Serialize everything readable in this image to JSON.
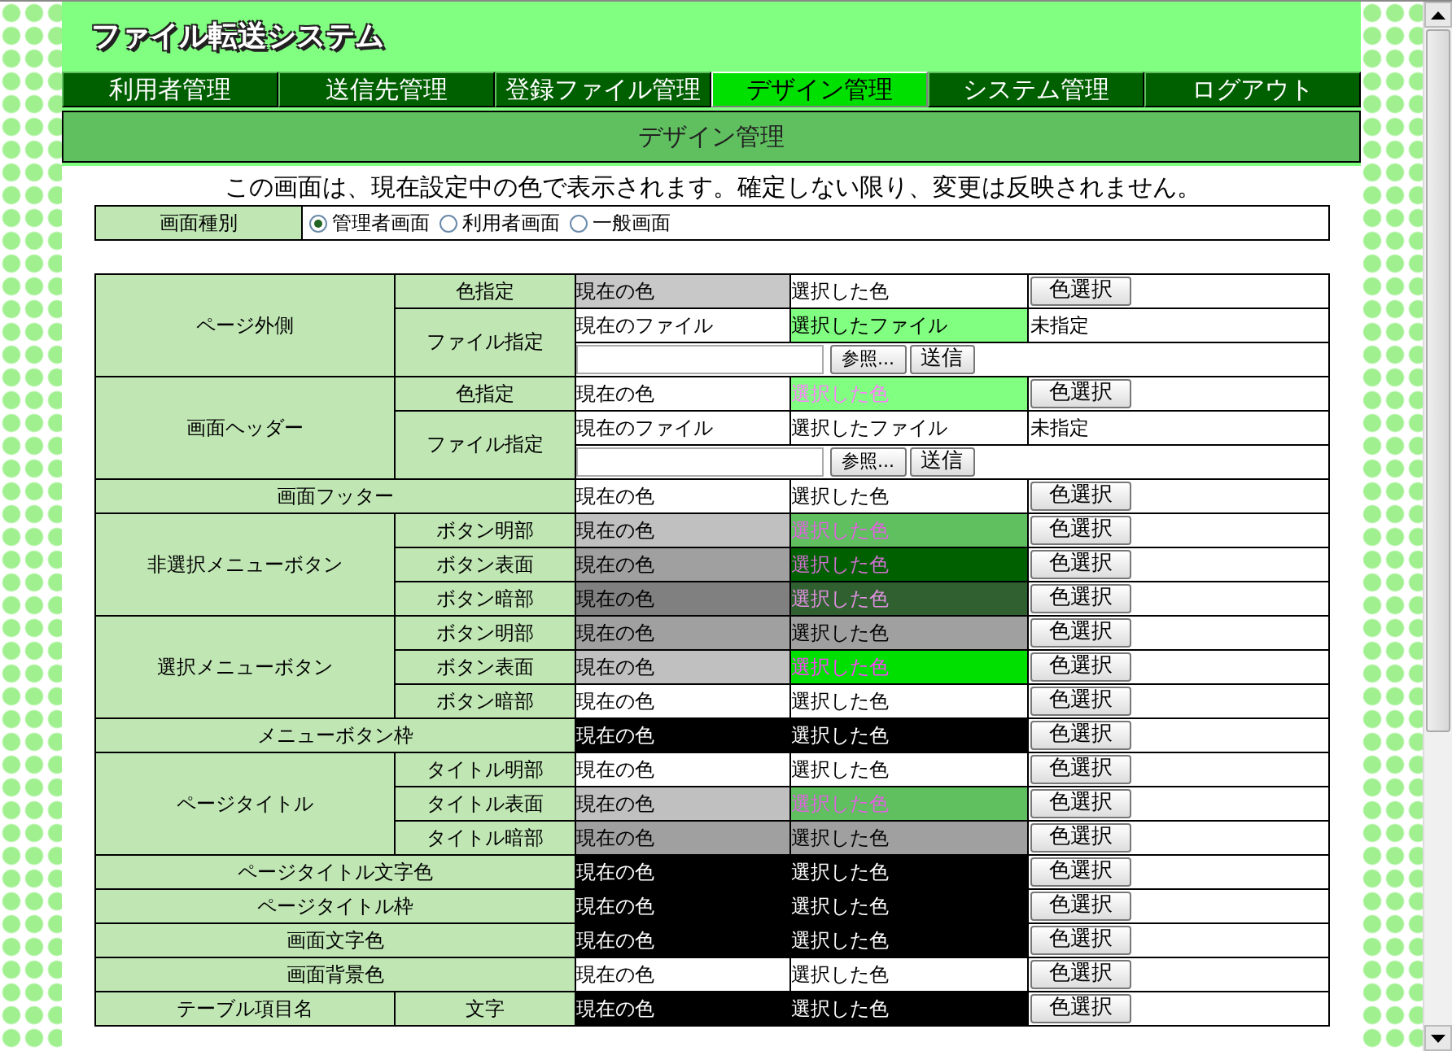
{
  "logo": "ファイル転送システム",
  "menu": [
    {
      "label": "利用者管理",
      "selected": false
    },
    {
      "label": "送信先管理",
      "selected": false
    },
    {
      "label": "登録ファイル管理",
      "selected": false
    },
    {
      "label": "デザイン管理",
      "selected": true
    },
    {
      "label": "システム管理",
      "selected": false
    },
    {
      "label": "ログアウト",
      "selected": false
    }
  ],
  "page_title": "デザイン管理",
  "notice": "この画面は、現在設定中の色で表示されます。確定しない限り、変更は反映されません。",
  "screen_type": {
    "label": "画面種別",
    "options": [
      {
        "label": "管理者画面",
        "selected": true
      },
      {
        "label": "利用者画面",
        "selected": false
      },
      {
        "label": "一般画面",
        "selected": false
      }
    ]
  },
  "settings": [
    {
      "label": "ページ外側",
      "items": [
        {
          "label": "色指定",
          "kind": "color",
          "current": {
            "text": "現在の色",
            "color": "#c8c8c8"
          },
          "chosen": {
            "text": "選択した色",
            "color": "#ffffff"
          },
          "button": "色選択"
        },
        {
          "label": "ファイル指定",
          "kind": "file",
          "current": {
            "text": "現在のファイル",
            "color": "#ffffff"
          },
          "chosen": {
            "text": "選択したファイル",
            "color": "#80ff80"
          },
          "status": "未指定",
          "browse_button": "参照...",
          "send_button": "送信"
        }
      ]
    },
    {
      "label": "画面ヘッダー",
      "items": [
        {
          "label": "色指定",
          "kind": "color",
          "current": {
            "text": "現在の色",
            "color": "#ffffff"
          },
          "chosen": {
            "text": "選択した色",
            "color": "#80ff80",
            "ink": {
              "color": "#ff80ff"
            }
          },
          "button": "色選択"
        },
        {
          "label": "ファイル指定",
          "kind": "file",
          "current": {
            "text": "現在のファイル",
            "color": "#ffffff"
          },
          "chosen": {
            "text": "選択したファイル",
            "color": "#ffffff"
          },
          "status": "未指定",
          "browse_button": "参照...",
          "send_button": "送信"
        }
      ]
    },
    {
      "label": "画面フッター",
      "items": [
        {
          "kind": "color",
          "current": {
            "text": "現在の色",
            "color": "#ffffff"
          },
          "chosen": {
            "text": "選択した色",
            "color": "#ffffff"
          },
          "button": "色選択"
        }
      ]
    },
    {
      "label": "非選択メニューボタン",
      "items": [
        {
          "label": "ボタン明部",
          "kind": "color",
          "current": {
            "text": "現在の色",
            "color": "#c0c0c0"
          },
          "chosen": {
            "text": "選択した色",
            "color": "#60c060",
            "ink": {
              "color": "#e060e0"
            }
          },
          "button": "色選択"
        },
        {
          "label": "ボタン表面",
          "kind": "color",
          "current": {
            "text": "現在の色",
            "color": "#a0a0a0"
          },
          "chosen": {
            "text": "選択した色",
            "color": "#006000",
            "ink": {
              "color": "#d070d0"
            }
          },
          "button": "色選択"
        },
        {
          "label": "ボタン暗部",
          "kind": "color",
          "current": {
            "text": "現在の色",
            "color": "#808080"
          },
          "chosen": {
            "text": "選択した色",
            "color": "#306030",
            "ink": {
              "color": "#e090e0"
            }
          },
          "button": "色選択"
        }
      ]
    },
    {
      "label": "選択メニューボタン",
      "items": [
        {
          "label": "ボタン明部",
          "kind": "color",
          "current": {
            "text": "現在の色",
            "color": "#a0a0a0"
          },
          "chosen": {
            "text": "選択した色",
            "color": "#a0a0a0"
          },
          "button": "色選択"
        },
        {
          "label": "ボタン表面",
          "kind": "color",
          "current": {
            "text": "現在の色",
            "color": "#c0c0c0"
          },
          "chosen": {
            "text": "選択した色",
            "color": "#00e000",
            "ink": {
              "color": "#ff40ff"
            }
          },
          "button": "色選択"
        },
        {
          "label": "ボタン暗部",
          "kind": "color",
          "current": {
            "text": "現在の色",
            "color": "#ffffff"
          },
          "chosen": {
            "text": "選択した色",
            "color": "#ffffff"
          },
          "button": "色選択"
        }
      ]
    },
    {
      "label": "メニューボタン枠",
      "items": [
        {
          "kind": "color",
          "current": {
            "text": "現在の色",
            "color": "#000000"
          },
          "chosen": {
            "text": "選択した色",
            "color": "#000000"
          },
          "button": "色選択"
        }
      ]
    },
    {
      "label": "ページタイトル",
      "items": [
        {
          "label": "タイトル明部",
          "kind": "color",
          "current": {
            "text": "現在の色",
            "color": "#ffffff"
          },
          "chosen": {
            "text": "選択した色",
            "color": "#ffffff"
          },
          "button": "色選択"
        },
        {
          "label": "タイトル表面",
          "kind": "color",
          "current": {
            "text": "現在の色",
            "color": "#c0c0c0"
          },
          "chosen": {
            "text": "選択した色",
            "color": "#60c060",
            "ink": {
              "color": "#e060e0"
            }
          },
          "button": "色選択"
        },
        {
          "label": "タイトル暗部",
          "kind": "color",
          "current": {
            "text": "現在の色",
            "color": "#a0a0a0"
          },
          "chosen": {
            "text": "選択した色",
            "color": "#a0a0a0"
          },
          "button": "色選択"
        }
      ]
    },
    {
      "label": "ページタイトル文字色",
      "items": [
        {
          "kind": "color",
          "current": {
            "text": "現在の色",
            "color": "#000000"
          },
          "chosen": {
            "text": "選択した色",
            "color": "#000000"
          },
          "button": "色選択"
        }
      ]
    },
    {
      "label": "ページタイトル枠",
      "items": [
        {
          "kind": "color",
          "current": {
            "text": "現在の色",
            "color": "#000000"
          },
          "chosen": {
            "text": "選択した色",
            "color": "#000000"
          },
          "button": "色選択"
        }
      ]
    },
    {
      "label": "画面文字色",
      "items": [
        {
          "kind": "color",
          "current": {
            "text": "現在の色",
            "color": "#000000"
          },
          "chosen": {
            "text": "選択した色",
            "color": "#000000"
          },
          "button": "色選択"
        }
      ]
    },
    {
      "label": "画面背景色",
      "items": [
        {
          "kind": "color",
          "current": {
            "text": "現在の色",
            "color": "#ffffff"
          },
          "chosen": {
            "text": "選択した色",
            "color": "#ffffff"
          },
          "button": "色選択"
        }
      ]
    },
    {
      "label": "テーブル項目名",
      "items": [
        {
          "label": "文字",
          "kind": "color",
          "current": {
            "text": "現在の色",
            "color": "#000000"
          },
          "chosen": {
            "text": "選択した色",
            "color": "#000000"
          },
          "button": "色選択"
        }
      ]
    }
  ]
}
